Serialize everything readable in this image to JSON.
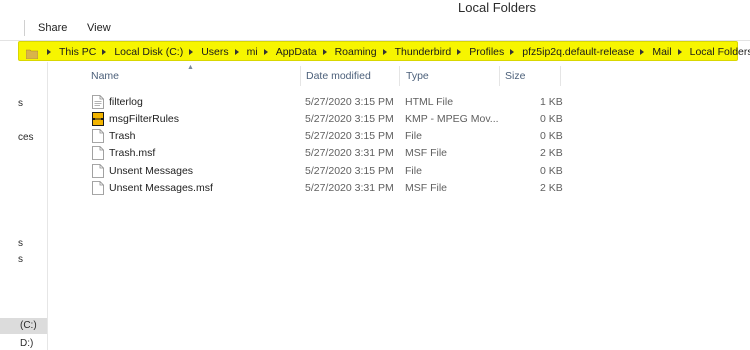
{
  "window": {
    "title": "Local Folders"
  },
  "ribbon": {
    "tabs": [
      "Share",
      "View"
    ]
  },
  "address_bar": {
    "crumbs": [
      "This PC",
      "Local Disk (C:)",
      "Users",
      "mi",
      "AppData",
      "Roaming",
      "Thunderbird",
      "Profiles",
      "pfz5ip2q.default-release",
      "Mail",
      "Local Folders"
    ],
    "highlight_color": "#f7f500"
  },
  "nav_fragments": [
    "s",
    "ces",
    "s",
    "s",
    "(C:)",
    "D:)"
  ],
  "columns": {
    "name": "Name",
    "date": "Date modified",
    "type": "Type",
    "size": "Size"
  },
  "files": [
    {
      "name": "filterlog",
      "date": "5/27/2020 3:15 PM",
      "type": "HTML File",
      "size": "1 KB",
      "icon": "html-file-icon"
    },
    {
      "name": "msgFilterRules",
      "date": "5/27/2020 3:15 PM",
      "type": "KMP - MPEG Mov...",
      "size": "0 KB",
      "icon": "kmp-media-file-icon"
    },
    {
      "name": "Trash",
      "date": "5/27/2020 3:15 PM",
      "type": "File",
      "size": "0 KB",
      "icon": "blank-file-icon"
    },
    {
      "name": "Trash.msf",
      "date": "5/27/2020 3:31 PM",
      "type": "MSF File",
      "size": "2 KB",
      "icon": "blank-file-icon"
    },
    {
      "name": "Unsent Messages",
      "date": "5/27/2020 3:15 PM",
      "type": "File",
      "size": "0 KB",
      "icon": "blank-file-icon"
    },
    {
      "name": "Unsent Messages.msf",
      "date": "5/27/2020 3:31 PM",
      "type": "MSF File",
      "size": "2 KB",
      "icon": "blank-file-icon"
    }
  ]
}
